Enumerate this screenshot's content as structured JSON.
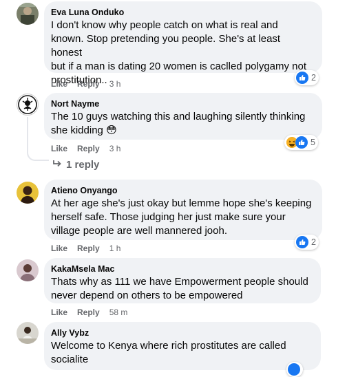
{
  "actions": {
    "like": "Like",
    "reply": "Reply"
  },
  "comments": [
    {
      "author": "Eva Luna Onduko",
      "lines": [
        "I don't know why people catch on what is real and",
        "known. Stop pretending you people. She's at least honest",
        "but if a man is dating 20 women is caclled polygamy not",
        "prostitution.."
      ],
      "time": "3 h",
      "reaction_count": "2",
      "reactions": [
        "like-icon"
      ]
    },
    {
      "author": "Nort Nayme",
      "lines": [
        "The 10 guys watching this and laughing silently thinking",
        "she kidding"
      ],
      "emoji": "😳",
      "time": "3 h",
      "reaction_count": "5",
      "reactions": [
        "haha-icon",
        "like-icon"
      ],
      "replies_link": "1 reply"
    },
    {
      "author": "Atieno Onyango",
      "lines": [
        "At her age she's just okay but lemme hope she's keeping",
        "herself safe. Those judging her just make sure your",
        "village people are well mannered jooh."
      ],
      "time": "1 h",
      "reaction_count": "2",
      "reactions": [
        "like-icon"
      ]
    },
    {
      "author": "KakaMsela Mac",
      "lines": [
        "Thats why as 111 we have Empowerment people should",
        "never depend on others to be empowered"
      ],
      "time": "58 m"
    },
    {
      "author": "Ally Vybz",
      "lines": [
        "Welcome to Kenya where rich prostitutes are called",
        "socialite"
      ]
    }
  ],
  "colors": {
    "bubble": "#f0f2f5",
    "meta": "#65676b",
    "like_blue": "#1877f2",
    "haha_yellow": "#f7b125"
  }
}
